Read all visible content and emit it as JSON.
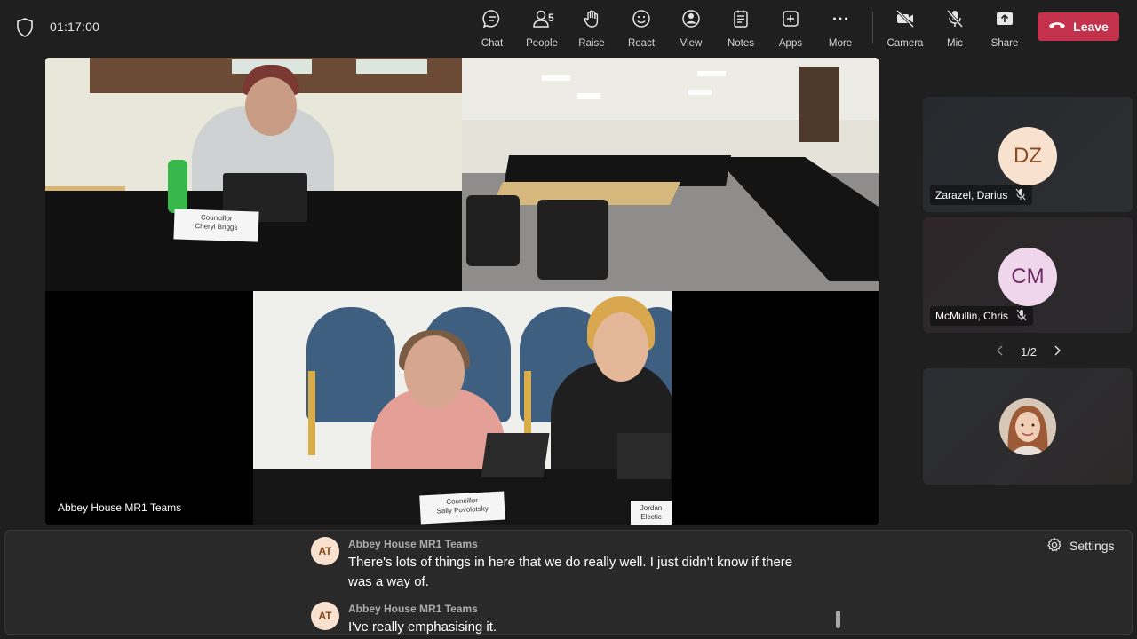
{
  "meeting": {
    "timer": "01:17:00"
  },
  "toolbar": {
    "chat_label": "Chat",
    "people_label": "People",
    "people_count": "5",
    "raise_label": "Raise",
    "react_label": "React",
    "view_label": "View",
    "notes_label": "Notes",
    "apps_label": "Apps",
    "more_label": "More",
    "camera_label": "Camera",
    "mic_label": "Mic",
    "share_label": "Share",
    "leave_label": "Leave"
  },
  "stage": {
    "name": "Abbey House MR1 Teams",
    "nameplate_a_line1": "Councillor",
    "nameplate_a_line2": "Cheryl Briggs",
    "nameplate_c_line1": "Councillor",
    "nameplate_c_line2": "Sally Povolotsky",
    "nameplate_c2_line1": "Jordan",
    "nameplate_c2_line2": "Electic"
  },
  "participants": [
    {
      "initials": "DZ",
      "name": "Zarazel, Darius"
    },
    {
      "initials": "CM",
      "name": "McMullin, Chris"
    }
  ],
  "pager": {
    "label": "1/2"
  },
  "captions": {
    "settings_label": "Settings",
    "entries": [
      {
        "initials": "AT",
        "speaker": "Abbey House MR1 Teams",
        "text": "There's lots of things in here that we do really well. I just didn't know if there was a way of."
      },
      {
        "initials": "AT",
        "speaker": "Abbey House MR1 Teams",
        "text": "I've really emphasising it."
      }
    ]
  },
  "colors": {
    "leave": "#c4314b",
    "background": "#1f1f1f",
    "panel": "#292929"
  }
}
